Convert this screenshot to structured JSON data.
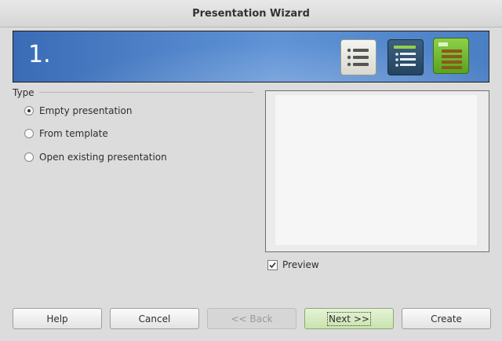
{
  "window": {
    "title": "Presentation Wizard"
  },
  "banner": {
    "step": "1.",
    "icons": [
      "list-icon",
      "slide-list-icon",
      "green-list-icon"
    ]
  },
  "type_group": {
    "label": "Type",
    "options": [
      {
        "label": "Empty presentation",
        "selected": true
      },
      {
        "label": "From template",
        "selected": false
      },
      {
        "label": "Open existing presentation",
        "selected": false
      }
    ]
  },
  "preview": {
    "checkbox_label": "Preview",
    "checked": true
  },
  "buttons": {
    "help": "Help",
    "cancel": "Cancel",
    "back": "<< Back",
    "next": "Next >>",
    "create": "Create"
  },
  "colors": {
    "banner_blue": "#4a7fc4",
    "focused_button": "#c9e3ae"
  }
}
